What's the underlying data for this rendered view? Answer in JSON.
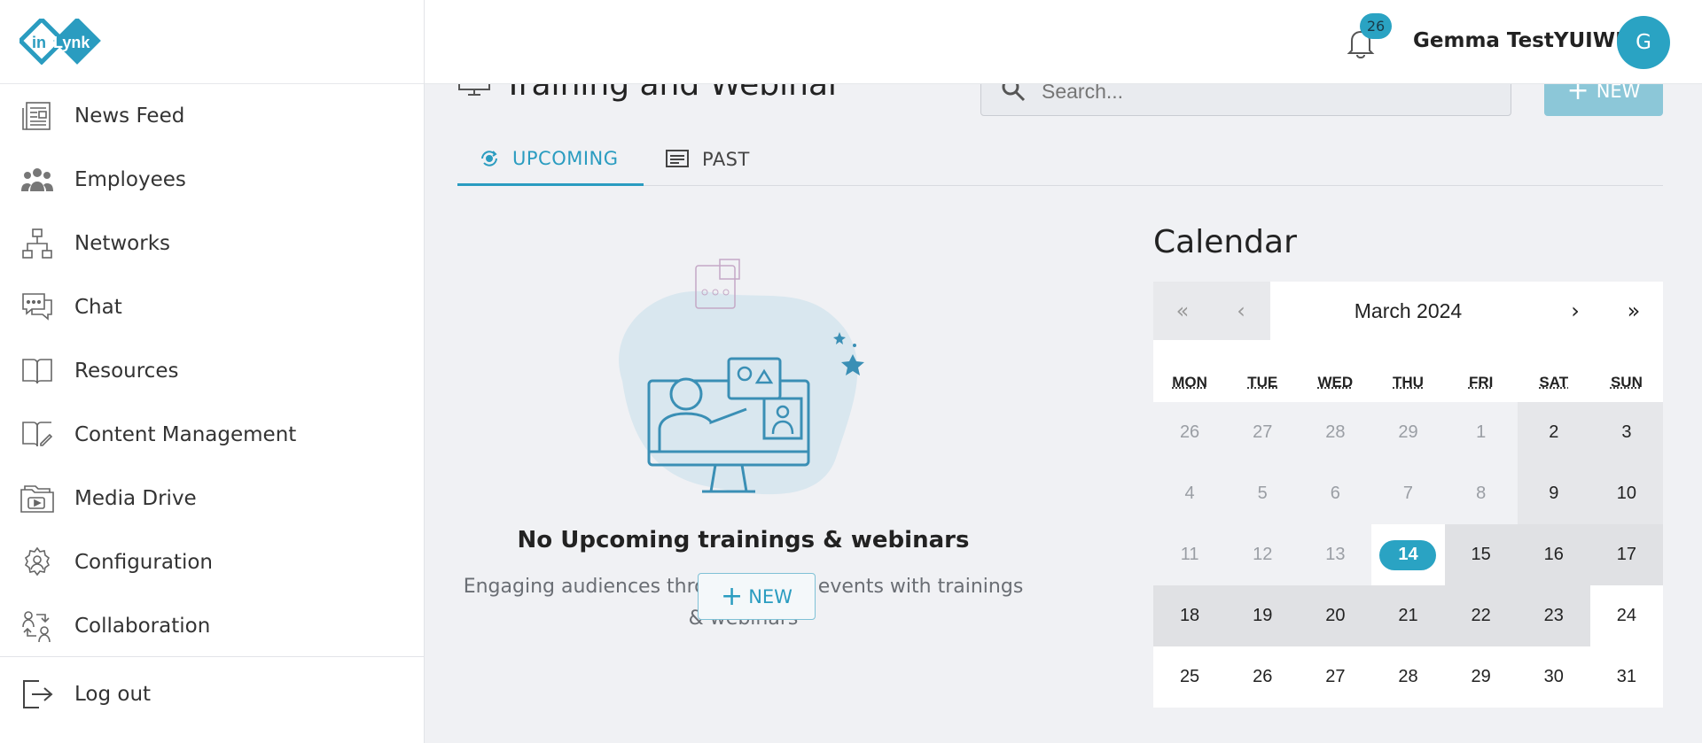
{
  "app": {
    "logo_text_in": "in",
    "logo_text_lynk": "Lynk"
  },
  "sidebar": {
    "items": [
      {
        "label": "News Feed",
        "icon": "newspaper-icon"
      },
      {
        "label": "Employees",
        "icon": "people-icon"
      },
      {
        "label": "Networks",
        "icon": "network-icon"
      },
      {
        "label": "Chat",
        "icon": "chat-icon"
      },
      {
        "label": "Resources",
        "icon": "book-icon"
      },
      {
        "label": "Content Management",
        "icon": "book-edit-icon"
      },
      {
        "label": "Media Drive",
        "icon": "media-folder-icon"
      },
      {
        "label": "Configuration",
        "icon": "gear-person-icon"
      },
      {
        "label": "Collaboration",
        "icon": "collaboration-icon"
      }
    ],
    "logout_label": "Log out"
  },
  "header": {
    "notification_count": "26",
    "user_name": "Gemma TestYUIWU",
    "avatar_initial": "G"
  },
  "main": {
    "title": "Training and Webinar",
    "search_placeholder": "Search...",
    "new_label": "NEW",
    "tabs": [
      {
        "label": "UPCOMING",
        "active": true
      },
      {
        "label": "PAST",
        "active": false
      }
    ],
    "empty_title": "No Upcoming trainings & webinars",
    "empty_subtitle": "Engaging audiences through virtual events with trainings & webinars",
    "empty_new_label": "NEW"
  },
  "calendar": {
    "title": "Calendar",
    "month_label": "March 2024",
    "nav": {
      "prev_year": "«",
      "prev_month": "‹",
      "next_month": "›",
      "next_year": "»"
    },
    "weekdays": [
      "MON",
      "TUE",
      "WED",
      "THU",
      "FRI",
      "SAT",
      "SUN"
    ],
    "today": "14",
    "days": [
      "26",
      "27",
      "28",
      "29",
      "1",
      "2",
      "3",
      "4",
      "5",
      "6",
      "7",
      "8",
      "9",
      "10",
      "11",
      "12",
      "13",
      "14",
      "15",
      "16",
      "17",
      "18",
      "19",
      "20",
      "21",
      "22",
      "23",
      "24",
      "25",
      "26",
      "27",
      "28",
      "29",
      "30",
      "31"
    ]
  },
  "colors": {
    "accent": "#2aa3c3",
    "accent_light": "#8cc7d8"
  }
}
